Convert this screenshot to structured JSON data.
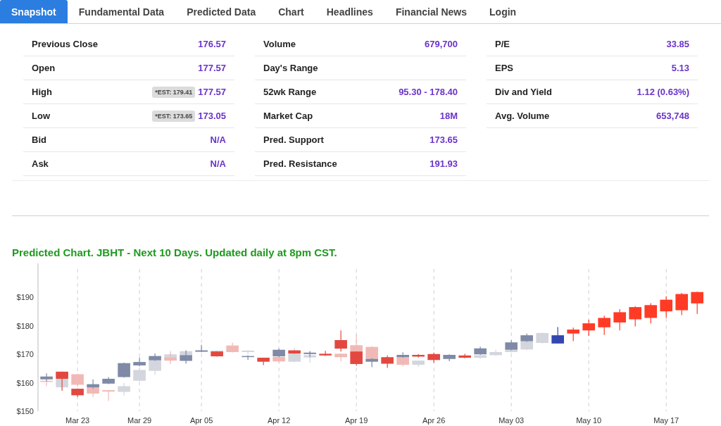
{
  "tabs": [
    {
      "label": "Snapshot",
      "selected": true
    },
    {
      "label": "Fundamental Data",
      "selected": false
    },
    {
      "label": "Predicted Data",
      "selected": false
    },
    {
      "label": "Chart",
      "selected": false
    },
    {
      "label": "Headlines",
      "selected": false
    },
    {
      "label": "Financial News",
      "selected": false
    },
    {
      "label": "Login",
      "selected": false
    }
  ],
  "snapshot": {
    "columns": [
      [
        {
          "label": "Previous Close",
          "value": "176.57"
        },
        {
          "label": "Open",
          "value": "177.57"
        },
        {
          "label": "High",
          "estimate": "*EST: 179.41",
          "value": "177.57"
        },
        {
          "label": "Low",
          "estimate": "*EST: 173.65",
          "value": "173.05"
        },
        {
          "label": "Bid",
          "value": "N/A"
        },
        {
          "label": "Ask",
          "value": "N/A"
        }
      ],
      [
        {
          "label": "Volume",
          "value": "679,700"
        },
        {
          "label": "Day's Range"
        },
        {
          "label": "52wk Range",
          "value": "95.30 - 178.40"
        },
        {
          "label": "Market Cap",
          "value": "18M"
        },
        {
          "label": "Pred. Support",
          "value": "173.65"
        },
        {
          "label": "Pred. Resistance",
          "value": "191.93"
        }
      ],
      [
        {
          "label": "P/E",
          "value": "33.85"
        },
        {
          "label": "EPS",
          "value": "5.13"
        },
        {
          "label": "Div and Yield",
          "value": "1.12 (0.63%)"
        },
        {
          "label": "Avg. Volume",
          "value": "653,748"
        }
      ]
    ]
  },
  "chart": {
    "title": "Predicted Chart. JBHT - Next 10 Days. Updated daily at 8pm CST.",
    "chart_data": {
      "type": "candlestick",
      "grid": true,
      "ylim": [
        150,
        200
      ],
      "yticks": [
        {
          "value": 150,
          "label": "$150"
        },
        {
          "value": 160,
          "label": "$160"
        },
        {
          "value": 170,
          "label": "$170"
        },
        {
          "value": 180,
          "label": "$180"
        },
        {
          "value": 190,
          "label": "$190"
        }
      ],
      "categories": [
        null,
        null,
        "Mar 23",
        null,
        null,
        null,
        "Mar 29",
        null,
        null,
        null,
        "Apr 05",
        null,
        null,
        null,
        null,
        "Apr 12",
        null,
        null,
        null,
        null,
        "Apr 19",
        null,
        null,
        null,
        null,
        "Apr 26",
        null,
        null,
        null,
        null,
        "May 03",
        null,
        null,
        null,
        null,
        "May 10",
        null,
        null,
        null,
        null,
        "May 17",
        null,
        null
      ],
      "series": [
        {
          "color": "#d3d6dd",
          "ohlc": [
            null,
            [
              158.4,
              161.6,
              158.2,
              161.4
            ],
            null,
            null,
            null,
            [
              156.8,
              159.9,
              155.5,
              158.8
            ],
            [
              160.7,
              164.7,
              160.5,
              164.5
            ],
            [
              164.2,
              168,
              162.8,
              167.9
            ],
            [
              167.8,
              171.2,
              167.6,
              170
            ],
            [
              169.6,
              171.3,
              169.4,
              171.1
            ],
            null,
            [
              171,
              171.5,
              170.8,
              171.3
            ],
            null,
            [
              170.8,
              171.4,
              170,
              171.3
            ],
            null,
            null,
            [
              167.4,
              172.3,
              167.2,
              170.3
            ],
            [
              168.9,
              171.1,
              167,
              169.7
            ],
            null,
            null,
            null,
            null,
            null,
            null,
            [
              166.3,
              167.8,
              165.6,
              167.8
            ],
            null,
            [
              168.3,
              169,
              167.8,
              168.7
            ],
            null,
            [
              168.8,
              169.8,
              168.4,
              169.7
            ],
            [
              169.7,
              171.6,
              169.4,
              170.8
            ],
            [
              170.8,
              171.6,
              170.6,
              171.5
            ],
            [
              171.7,
              174.6,
              171.5,
              174.6
            ],
            [
              174,
              177.6,
              173.8,
              177.5
            ],
            null,
            null,
            null,
            null,
            null,
            null,
            null,
            null,
            null,
            null
          ]
        },
        {
          "color": "#f1b9b5",
          "ohlc": [
            [
              160.3,
              160.8,
              158.8,
              160.7
            ],
            null,
            [
              159.3,
              163.2,
              158.6,
              163
            ],
            [
              156.2,
              159.6,
              155,
              158.4
            ],
            [
              156.9,
              157.4,
              153.6,
              157.4
            ],
            null,
            null,
            null,
            [
              167.8,
              170.6,
              166.6,
              168.9
            ],
            null,
            null,
            null,
            [
              170.8,
              174.1,
              170.6,
              173.1
            ],
            null,
            null,
            [
              167.5,
              169.1,
              167.1,
              169.1
            ],
            null,
            null,
            null,
            [
              169,
              170.3,
              167.6,
              170.2
            ],
            [
              171,
              176.9,
              169.8,
              173.2
            ],
            [
              168.4,
              172.9,
              168.2,
              172.6
            ],
            null,
            [
              166.3,
              169.2,
              165.8,
              169
            ],
            null,
            null,
            null,
            null,
            null,
            null,
            null,
            null,
            null,
            null,
            null,
            null,
            null,
            null,
            null,
            null,
            null,
            null,
            null
          ]
        },
        {
          "color": "#7e8aa6",
          "ohlc": [
            [
              161.2,
              163.3,
              160.5,
              162.2
            ],
            null,
            null,
            [
              158.4,
              161.2,
              158,
              159.5
            ],
            [
              159.7,
              162,
              159.5,
              161.4
            ],
            [
              162,
              167.1,
              161.8,
              166.9
            ],
            [
              166.1,
              168.9,
              165.8,
              167.3
            ],
            [
              167.9,
              170.3,
              167.7,
              169.4
            ],
            null,
            [
              167.7,
              171.4,
              166.7,
              169.7
            ],
            [
              170.9,
              173.3,
              170.7,
              171.4
            ],
            null,
            null,
            [
              169.1,
              169.6,
              168,
              169.4
            ],
            null,
            [
              169.3,
              172,
              169,
              171.6
            ],
            null,
            [
              170.1,
              171.1,
              169,
              170.6
            ],
            null,
            null,
            null,
            [
              167.4,
              168.6,
              165.5,
              168.4
            ],
            null,
            [
              169,
              170.7,
              168.8,
              169.8
            ],
            null,
            null,
            [
              168.4,
              170,
              167.6,
              169.8
            ],
            null,
            [
              170,
              172.7,
              169.8,
              172.1
            ],
            null,
            [
              171.6,
              175,
              171.4,
              174.2
            ],
            [
              174.6,
              177.3,
              174.4,
              176.7
            ],
            null,
            null,
            null,
            null,
            null,
            null,
            null,
            null,
            null,
            null,
            null
          ]
        },
        {
          "color": "#e2483f",
          "ohlc": [
            null,
            [
              161.4,
              163.9,
              157.2,
              163.9
            ],
            [
              155.6,
              158,
              155,
              157.9
            ],
            null,
            null,
            null,
            null,
            null,
            null,
            null,
            null,
            [
              169.3,
              171,
              169.2,
              171
            ],
            null,
            null,
            [
              167.4,
              168.8,
              166.2,
              168.8
            ],
            null,
            [
              170.3,
              171.4,
              170.2,
              171.4
            ],
            null,
            [
              169.6,
              171.2,
              169.4,
              170.2
            ],
            [
              172,
              178.4,
              171,
              175
            ],
            [
              166.6,
              171,
              166,
              171
            ],
            null,
            [
              166.7,
              169.6,
              165.2,
              169
            ],
            null,
            [
              169.2,
              170.1,
              168.9,
              169.8
            ],
            [
              168,
              170.6,
              167,
              170.1
            ],
            null,
            [
              168.8,
              170.2,
              168.6,
              169.6
            ],
            null,
            null,
            null,
            null,
            null,
            null,
            null,
            null,
            null,
            null,
            null,
            null,
            null,
            null,
            null
          ]
        },
        {
          "color": "#3447b0",
          "ohlc": [
            null,
            null,
            null,
            null,
            null,
            null,
            null,
            null,
            null,
            null,
            null,
            null,
            null,
            null,
            null,
            null,
            null,
            null,
            null,
            null,
            null,
            null,
            null,
            null,
            null,
            null,
            null,
            null,
            null,
            null,
            null,
            null,
            null,
            [
              173.8,
              179.6,
              173.8,
              176.7
            ],
            null,
            null,
            null,
            null,
            null,
            null,
            null,
            null,
            null
          ]
        },
        {
          "color": "#ff3b26",
          "ohlc": [
            null,
            null,
            null,
            null,
            null,
            null,
            null,
            null,
            null,
            null,
            null,
            null,
            null,
            null,
            null,
            null,
            null,
            null,
            null,
            null,
            null,
            null,
            null,
            null,
            null,
            null,
            null,
            null,
            null,
            null,
            null,
            null,
            null,
            null,
            [
              177.3,
              179.4,
              174.6,
              178.7
            ],
            [
              178.4,
              182.2,
              176.5,
              180.9
            ],
            [
              179.5,
              183.6,
              176.8,
              182.8
            ],
            [
              181.2,
              185.9,
              178.4,
              184.8
            ],
            [
              182.3,
              186.9,
              179.8,
              186.6
            ],
            [
              182.8,
              188,
              180.8,
              187.3
            ],
            [
              185.1,
              190.4,
              182.8,
              189.2
            ],
            [
              185.5,
              191.6,
              183.8,
              191.2
            ],
            [
              187.9,
              192,
              184.2,
              191.9
            ]
          ]
        }
      ]
    }
  }
}
